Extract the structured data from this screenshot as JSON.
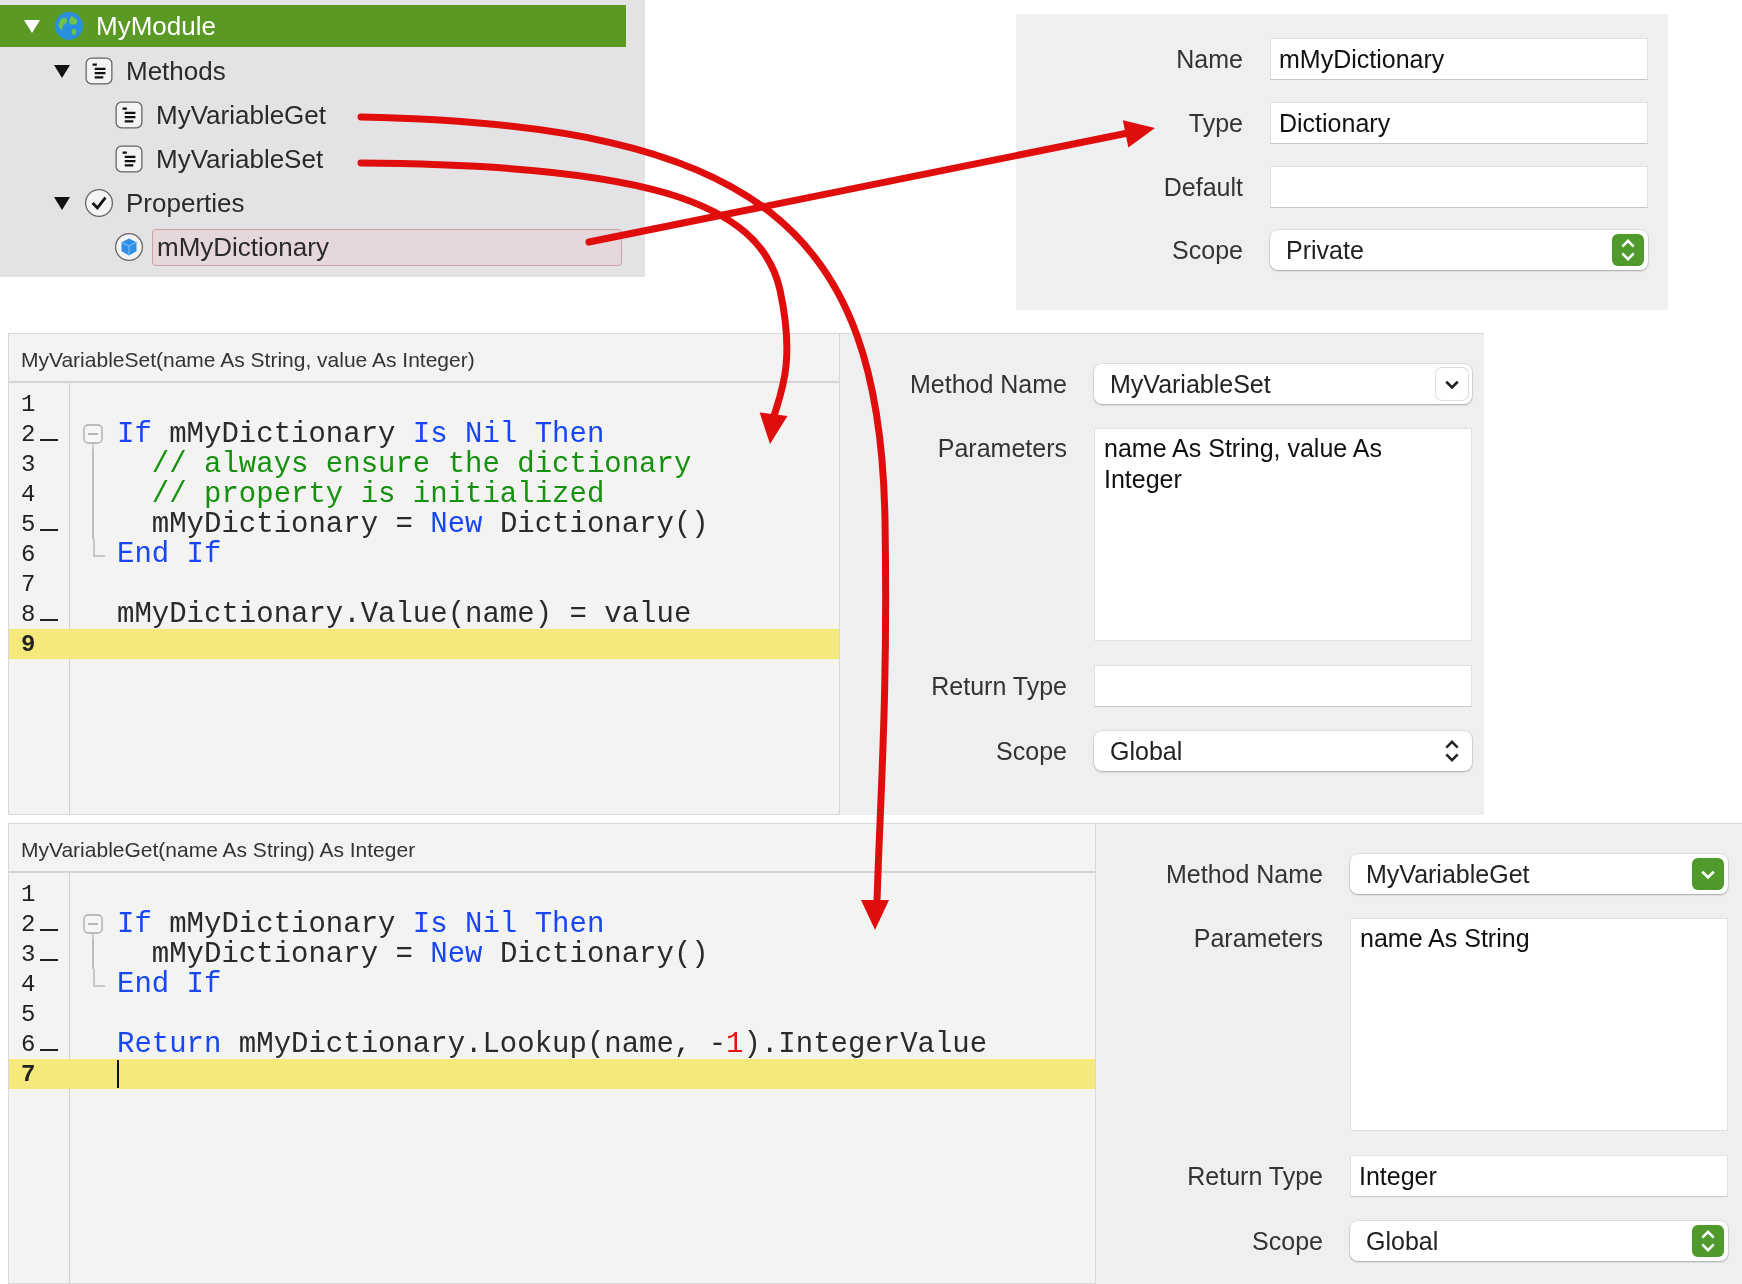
{
  "tree": [
    {
      "label": "MyModule",
      "kind": "module",
      "expanded": true,
      "selected": true,
      "highlighted": false,
      "children": [
        {
          "label": "Methods",
          "kind": "folder",
          "expanded": true,
          "selected": false,
          "highlighted": false,
          "children": [
            {
              "label": "MyVariableGet",
              "kind": "method",
              "selected": false,
              "highlighted": false
            },
            {
              "label": "MyVariableSet",
              "kind": "method",
              "selected": false,
              "highlighted": false
            }
          ]
        },
        {
          "label": "Properties",
          "kind": "group",
          "expanded": true,
          "selected": false,
          "highlighted": false,
          "children": [
            {
              "label": "mMyDictionary",
              "kind": "property",
              "selected": false,
              "highlighted": true
            }
          ]
        }
      ]
    }
  ],
  "inspector": {
    "rows": [
      {
        "label": "Name",
        "kind": "text",
        "value": "mMyDictionary"
      },
      {
        "label": "Type",
        "kind": "text",
        "value": "Dictionary"
      },
      {
        "label": "Default",
        "kind": "text"
      },
      {
        "label": "Scope",
        "kind": "popup",
        "value": "Private",
        "accent": true
      }
    ]
  },
  "editors": [
    {
      "signature": "MyVariableSet(name As String, value As Integer)",
      "lines": [
        {
          "num": "1",
          "kind": "line",
          "marked": false,
          "current": false
        },
        {
          "num": "2",
          "kind": "opener",
          "marked": true,
          "current": false,
          "tokens": [
            {
              "kind": "keyword",
              "text": "If"
            },
            {
              "kind": "plain",
              "text": " mMyDictionary "
            },
            {
              "kind": "keyword",
              "text": "Is Nil Then"
            }
          ]
        },
        {
          "num": "3",
          "kind": "inner",
          "marked": false,
          "current": false,
          "tokens": [
            {
              "kind": "comment",
              "text": "  // always ensure the dictionary"
            }
          ]
        },
        {
          "num": "4",
          "kind": "inner",
          "marked": false,
          "current": false,
          "tokens": [
            {
              "kind": "comment",
              "text": "  // property is initialized"
            }
          ]
        },
        {
          "num": "5",
          "kind": "inner",
          "marked": true,
          "current": false,
          "tokens": [
            {
              "kind": "plain",
              "text": "  mMyDictionary = "
            },
            {
              "kind": "keyword",
              "text": "New"
            },
            {
              "kind": "plain",
              "text": " Dictionary()"
            }
          ]
        },
        {
          "num": "6",
          "kind": "closer",
          "marked": false,
          "current": false,
          "tokens": [
            {
              "kind": "keyword",
              "text": "End If"
            }
          ]
        },
        {
          "num": "7",
          "kind": "line",
          "marked": false,
          "current": false
        },
        {
          "num": "8",
          "kind": "line",
          "marked": true,
          "current": false,
          "tokens": [
            {
              "kind": "plain",
              "text": "mMyDictionary.Value(name) = value"
            }
          ]
        },
        {
          "num": "9",
          "kind": "line",
          "marked": false,
          "current": true
        }
      ],
      "fields": [
        {
          "label": "Method Name",
          "kind": "combo",
          "value": "MyVariableSet",
          "accent": false
        },
        {
          "label": "Parameters",
          "kind": "textarea",
          "value": "name As String, value As Integer"
        },
        {
          "label": "Return Type",
          "kind": "text"
        },
        {
          "label": "Scope",
          "kind": "popup",
          "value": "Global",
          "accent": false
        }
      ]
    },
    {
      "signature": "MyVariableGet(name As String) As Integer",
      "lines": [
        {
          "num": "1",
          "kind": "line",
          "marked": false,
          "current": false
        },
        {
          "num": "2",
          "kind": "opener",
          "marked": true,
          "current": false,
          "tokens": [
            {
              "kind": "keyword",
              "text": "If"
            },
            {
              "kind": "plain",
              "text": " mMyDictionary "
            },
            {
              "kind": "keyword",
              "text": "Is Nil Then"
            }
          ]
        },
        {
          "num": "3",
          "kind": "inner",
          "marked": true,
          "current": false,
          "tokens": [
            {
              "kind": "plain",
              "text": "  mMyDictionary = "
            },
            {
              "kind": "keyword",
              "text": "New"
            },
            {
              "kind": "plain",
              "text": " Dictionary()"
            }
          ]
        },
        {
          "num": "4",
          "kind": "closer",
          "marked": false,
          "current": false,
          "tokens": [
            {
              "kind": "keyword",
              "text": "End If"
            }
          ]
        },
        {
          "num": "5",
          "kind": "line",
          "marked": false,
          "current": false
        },
        {
          "num": "6",
          "kind": "line",
          "marked": true,
          "current": false,
          "tokens": [
            {
              "kind": "keyword",
              "text": "Return"
            },
            {
              "kind": "plain",
              "text": " mMyDictionary.Lookup(name, -"
            },
            {
              "kind": "number",
              "text": "1"
            },
            {
              "kind": "plain",
              "text": ").IntegerValue"
            }
          ]
        },
        {
          "num": "7",
          "kind": "line",
          "marked": false,
          "current": true,
          "caret": true
        }
      ],
      "fields": [
        {
          "label": "Method Name",
          "kind": "combo",
          "value": "MyVariableGet",
          "accent": true
        },
        {
          "label": "Parameters",
          "kind": "textarea",
          "value": "name As String"
        },
        {
          "label": "Return Type",
          "kind": "text",
          "value": "Integer"
        },
        {
          "label": "Scope",
          "kind": "popup",
          "value": "Global",
          "accent": true
        }
      ]
    }
  ]
}
